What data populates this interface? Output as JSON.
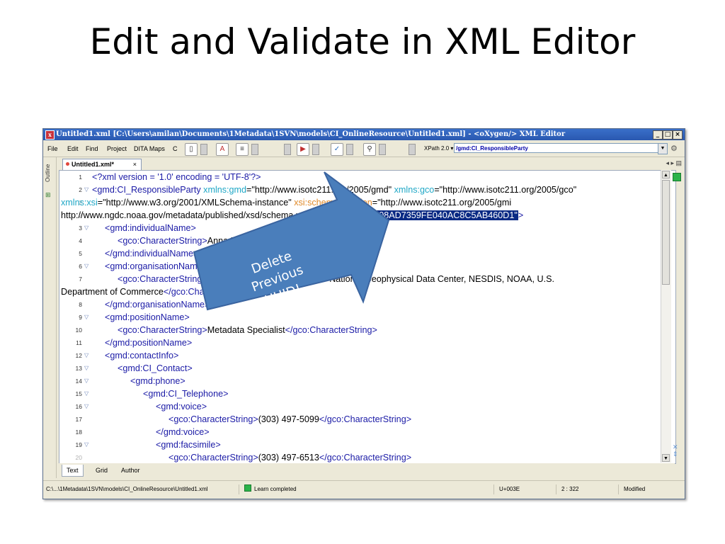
{
  "slide": {
    "title": "Edit and Validate in XML Editor"
  },
  "window": {
    "title": "Untitled1.xml [C:\\Users\\amilan\\Documents\\1Metadata\\1SVN\\models\\CI_OnlineResource\\Untitled1.xml] - <oXygen/> XML Editor",
    "btn_min": "_",
    "btn_max": "□",
    "btn_close": "×"
  },
  "menu": {
    "file": "File",
    "edit": "Edit",
    "find": "Find",
    "project": "Project",
    "dita_maps": "DITA Maps",
    "c": "C"
  },
  "xpath": {
    "label": "XPath 2.0 ▾",
    "value": "/gmd:CI_ResponsibleParty"
  },
  "side": {
    "outline": "Outline"
  },
  "tab": {
    "label": "Untitled1.xml*",
    "close": "×",
    "nav": "◂ ▸ ▤"
  },
  "editor": {
    "lines": [
      {
        "num": "1",
        "segments": [
          {
            "c": "t-tag",
            "t": "<?xml version = '1.0' encoding = 'UTF-8'?>"
          }
        ]
      },
      {
        "num": "2",
        "segments": [
          {
            "c": "t-tag",
            "t": "<gmd:CI_ResponsibleParty "
          },
          {
            "c": "t-attr",
            "t": "xmlns:gmd"
          },
          {
            "c": "t-val",
            "t": "=\"http://www.isotc211.org/2005/gmd\" "
          },
          {
            "c": "t-attr",
            "t": "xmlns:gco"
          },
          {
            "c": "t-val",
            "t": "=\"http://www.isotc211.org/2005/gco\""
          }
        ]
      },
      {
        "num": "2",
        "segments": [
          {
            "c": "t-attr",
            "t": "xmlns:xsi"
          },
          {
            "c": "t-val",
            "t": "=\"http://www.w3.org/2001/XMLSchema-instance\" "
          },
          {
            "c": "t-xsi",
            "t": "xsi:schemaLocation"
          },
          {
            "c": "t-val",
            "t": "=\"http://www.isotc211.org/2005/gmi"
          }
        ]
      },
      {
        "num": "2",
        "segments": [
          {
            "c": "t-val",
            "t": "http://www.ngdc.noaa.gov/metadata/published/xsd/schema.xsd\" "
          },
          {
            "c": "sel",
            "t": "uuid=\"8294BEE08AD7359FE040AC8C5AB460D1\""
          },
          {
            "c": "t-tag",
            "t": ">"
          }
        ]
      },
      {
        "num": "3",
        "segments": [
          {
            "c": "t-tag",
            "t": "<gmd:individualName>"
          }
        ]
      },
      {
        "num": "4",
        "segments": [
          {
            "c": "t-tag",
            "t": "<gco:CharacterString>"
          },
          {
            "c": "t-txt",
            "t": "Anna Milan"
          },
          {
            "c": "t-tag",
            "t": "</gco:CharacterString>"
          }
        ]
      },
      {
        "num": "5",
        "segments": [
          {
            "c": "t-tag",
            "t": "</gmd:individualName>"
          }
        ]
      },
      {
        "num": "6",
        "segments": [
          {
            "c": "t-tag",
            "t": "<gmd:organisationName>"
          }
        ]
      },
      {
        "num": "7",
        "segments": [
          {
            "c": "t-tag",
            "t": "<gco:CharacterString>"
          },
          {
            "c": "t-txt",
            "t": "DOC/NOAA/NESDIS/NGDC > National Geophysical Data Center, NESDIS, NOAA, U.S."
          }
        ]
      },
      {
        "num": "7",
        "segments": [
          {
            "c": "t-txt",
            "t": "Department of Commerce"
          },
          {
            "c": "t-tag",
            "t": "</gco:CharacterString>"
          }
        ]
      },
      {
        "num": "8",
        "segments": [
          {
            "c": "t-tag",
            "t": "</gmd:organisationName>"
          }
        ]
      },
      {
        "num": "9",
        "segments": [
          {
            "c": "t-tag",
            "t": "<gmd:positionName>"
          }
        ]
      },
      {
        "num": "10",
        "segments": [
          {
            "c": "t-tag",
            "t": "<gco:CharacterString>"
          },
          {
            "c": "t-txt",
            "t": "Metadata Specialist"
          },
          {
            "c": "t-tag",
            "t": "</gco:CharacterString>"
          }
        ]
      },
      {
        "num": "11",
        "segments": [
          {
            "c": "t-tag",
            "t": "</gmd:positionName>"
          }
        ]
      },
      {
        "num": "12",
        "segments": [
          {
            "c": "t-tag",
            "t": "<gmd:contactInfo>"
          }
        ]
      },
      {
        "num": "13",
        "segments": [
          {
            "c": "t-tag",
            "t": "<gmd:CI_Contact>"
          }
        ]
      },
      {
        "num": "14",
        "segments": [
          {
            "c": "t-tag",
            "t": "<gmd:phone>"
          }
        ]
      },
      {
        "num": "15",
        "segments": [
          {
            "c": "t-tag",
            "t": "<gmd:CI_Telephone>"
          }
        ]
      },
      {
        "num": "16",
        "segments": [
          {
            "c": "t-tag",
            "t": "<gmd:voice>"
          }
        ]
      },
      {
        "num": "17",
        "segments": [
          {
            "c": "t-tag",
            "t": "<gco:CharacterString>"
          },
          {
            "c": "t-txt",
            "t": "(303) 497-5099"
          },
          {
            "c": "t-tag",
            "t": "</gco:CharacterString>"
          }
        ]
      },
      {
        "num": "18",
        "segments": [
          {
            "c": "t-tag",
            "t": "</gmd:voice>"
          }
        ]
      },
      {
        "num": "19",
        "segments": [
          {
            "c": "t-tag",
            "t": "<gmd:facsimile>"
          }
        ]
      },
      {
        "num": "20",
        "segments": [
          {
            "c": "t-tag",
            "t": "<gco:CharacterString>"
          },
          {
            "c": "t-txt",
            "t": "(303) 497-6513"
          },
          {
            "c": "t-tag",
            "t": "</gco:CharacterString>"
          }
        ]
      }
    ]
  },
  "modes": {
    "text": "Text",
    "grid": "Grid",
    "author": "Author"
  },
  "status": {
    "path": "C:\\...\\1Metadata\\1SVN\\models\\CI_OnlineResource\\Untitled1.xml",
    "learn": "Learn completed",
    "unicode": "U+003E",
    "position": "2 : 322",
    "state": "Modified"
  },
  "callout": {
    "line1": "Delete Previous",
    "line2": "UUID!"
  },
  "colors": {
    "callout_fill": "#4a7ebb",
    "callout_stroke": "#3a64a0",
    "selection": "#0a2a84",
    "titlebar": "#2a58b0"
  }
}
